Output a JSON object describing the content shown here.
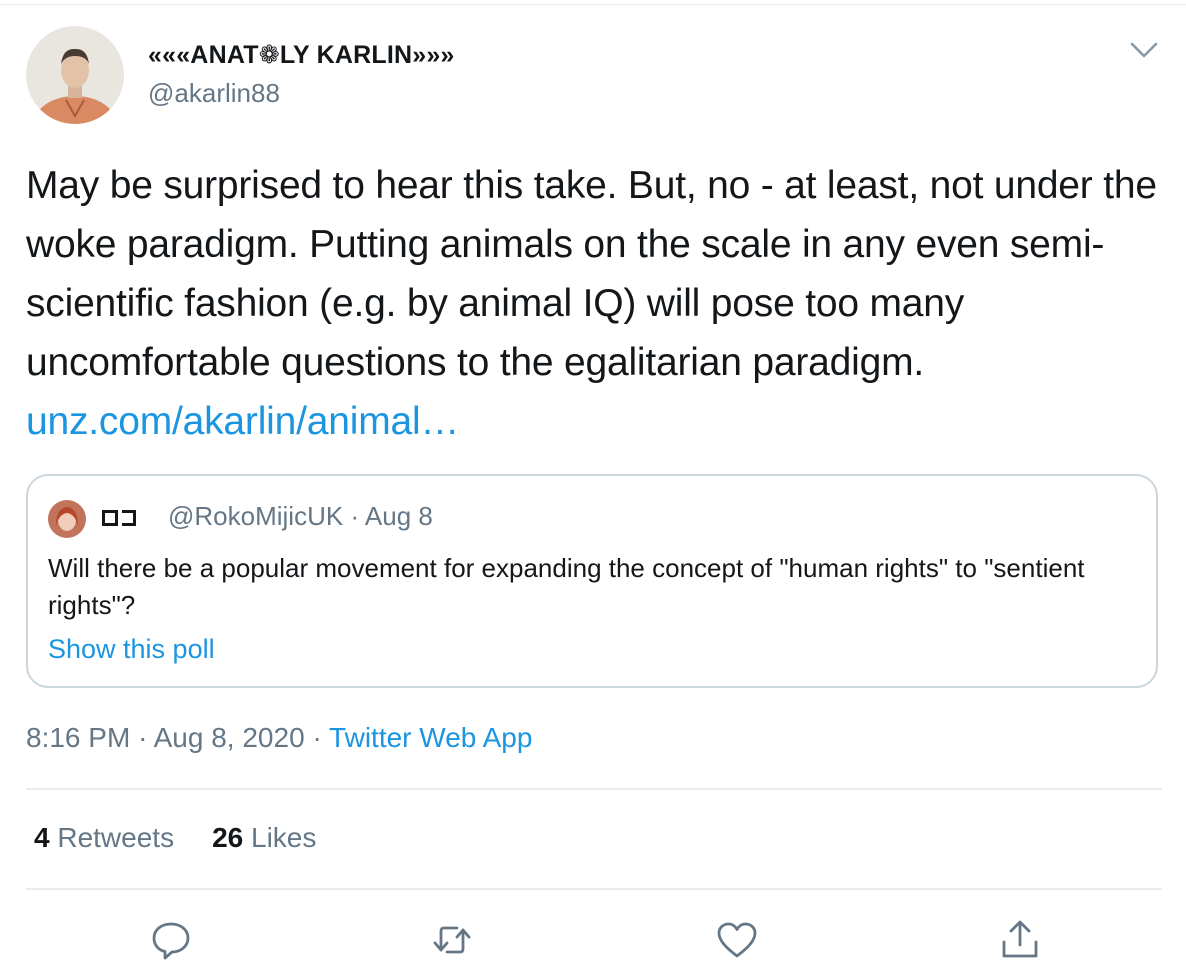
{
  "author": {
    "display_name": "«««ANAT❁LY KARLIN»»»",
    "handle": "@akarlin88"
  },
  "tweet": {
    "text": "May be surprised to hear this take. But, no - at least, not under the woke paradigm. Putting animals on the scale in any even semi-scientific fashion (e.g. by animal IQ) will pose too many uncomfortable questions to the egalitarian paradigm.",
    "link_text": "unz.com/akarlin/animal…"
  },
  "quoted_tweet": {
    "name_glyphs": "□□",
    "handle": "@RokoMijicUK",
    "separator": "·",
    "date": "Aug 8",
    "text": "Will there be a popular movement for expanding the concept of \"human rights\" to \"sentient rights\"?",
    "poll_link": "Show this poll"
  },
  "meta": {
    "time": "8:16 PM",
    "separator": "·",
    "date": "Aug 8, 2020",
    "separator2": "·",
    "source": "Twitter Web App"
  },
  "stats": {
    "retweets_count": "4",
    "retweets_label": "Retweets",
    "likes_count": "26",
    "likes_label": "Likes"
  },
  "actions": [
    {
      "icon": "reply-icon"
    },
    {
      "icon": "retweet-icon"
    },
    {
      "icon": "like-icon"
    },
    {
      "icon": "share-icon"
    }
  ],
  "colors": {
    "text": "#14171a",
    "secondary": "#657786",
    "link": "#1b95e0",
    "border": "#ccd6dd",
    "divider": "#e6ecf0"
  }
}
